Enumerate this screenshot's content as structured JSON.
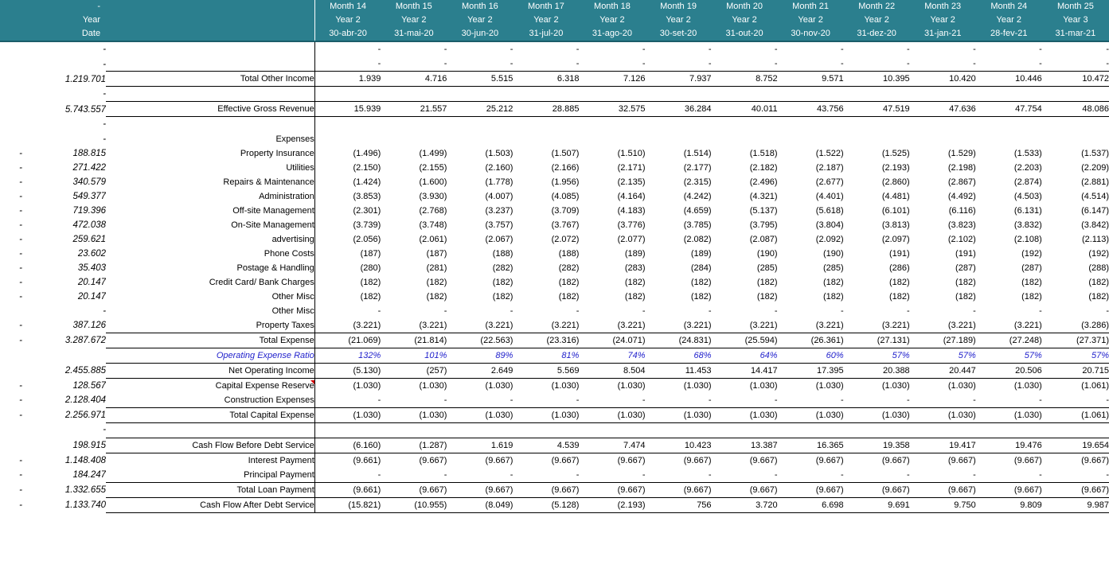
{
  "header": {
    "left_blank_label": "-",
    "row_labels": [
      "",
      "Year",
      "Date"
    ],
    "columns": [
      {
        "month": "Month 14",
        "year": "Year 2",
        "date": "30-abr-20"
      },
      {
        "month": "Month 15",
        "year": "Year 2",
        "date": "31-mai-20"
      },
      {
        "month": "Month 16",
        "year": "Year 2",
        "date": "30-jun-20"
      },
      {
        "month": "Month 17",
        "year": "Year 2",
        "date": "31-jul-20"
      },
      {
        "month": "Month 18",
        "year": "Year 2",
        "date": "31-ago-20"
      },
      {
        "month": "Month 19",
        "year": "Year 2",
        "date": "30-set-20"
      },
      {
        "month": "Month 20",
        "year": "Year 2",
        "date": "31-out-20"
      },
      {
        "month": "Month 21",
        "year": "Year 2",
        "date": "30-nov-20"
      },
      {
        "month": "Month 22",
        "year": "Year 2",
        "date": "31-dez-20"
      },
      {
        "month": "Month 23",
        "year": "Year 2",
        "date": "31-jan-21"
      },
      {
        "month": "Month 24",
        "year": "Year 2",
        "date": "28-fev-21"
      },
      {
        "month": "Month 25",
        "year": "Year 3",
        "date": "31-mar-21"
      }
    ],
    "background_color": "#2b7f8e",
    "text_color": "#ffffff"
  },
  "colors": {
    "header_teal": "#2b7f8e",
    "oer_blue": "#2222cc",
    "comment_red": "#d40000",
    "text": "#000000"
  },
  "rows": [
    {
      "id": "blank-dash-1",
      "label": "",
      "sign": "",
      "ytd": "-",
      "values": [
        "-",
        "-",
        "-",
        "-",
        "-",
        "-",
        "-",
        "-",
        "-",
        "-",
        "-",
        "-"
      ]
    },
    {
      "id": "blank-dash-2",
      "label": "",
      "sign": "",
      "ytd": "-",
      "values": [
        "-",
        "-",
        "-",
        "-",
        "-",
        "-",
        "-",
        "-",
        "-",
        "-",
        "-",
        "-"
      ]
    },
    {
      "id": "total-other-income",
      "label": "Total Other Income",
      "sign": "",
      "ytd": "1.219.701",
      "values": [
        "1.939",
        "4.716",
        "5.515",
        "6.318",
        "7.126",
        "7.937",
        "8.752",
        "9.571",
        "10.395",
        "10.420",
        "10.446",
        "10.472"
      ]
    },
    {
      "id": "spacer-a",
      "label": "",
      "sign": "",
      "ytd": "-",
      "values": [
        "",
        "",
        "",
        "",
        "",
        "",
        "",
        "",
        "",
        "",
        "",
        ""
      ]
    },
    {
      "id": "effective-gross-revenue",
      "label": "Effective Gross Revenue",
      "sign": "",
      "ytd": "5.743.557",
      "values": [
        "15.939",
        "21.557",
        "25.212",
        "28.885",
        "32.575",
        "36.284",
        "40.011",
        "43.756",
        "47.519",
        "47.636",
        "47.754",
        "48.086"
      ]
    },
    {
      "id": "spacer-b",
      "label": "",
      "sign": "",
      "ytd": "-",
      "values": [
        "",
        "",
        "",
        "",
        "",
        "",
        "",
        "",
        "",
        "",
        "",
        ""
      ]
    },
    {
      "id": "expenses-heading",
      "label": "Expenses",
      "sign": "",
      "ytd": "-",
      "values": [
        "",
        "",
        "",
        "",
        "",
        "",
        "",
        "",
        "",
        "",
        "",
        ""
      ]
    },
    {
      "id": "property-insurance",
      "label": "Property Insurance",
      "sign": "-",
      "ytd": "188.815",
      "values": [
        "(1.496)",
        "(1.499)",
        "(1.503)",
        "(1.507)",
        "(1.510)",
        "(1.514)",
        "(1.518)",
        "(1.522)",
        "(1.525)",
        "(1.529)",
        "(1.533)",
        "(1.537)"
      ]
    },
    {
      "id": "utilities",
      "label": "Utilities",
      "sign": "-",
      "ytd": "271.422",
      "values": [
        "(2.150)",
        "(2.155)",
        "(2.160)",
        "(2.166)",
        "(2.171)",
        "(2.177)",
        "(2.182)",
        "(2.187)",
        "(2.193)",
        "(2.198)",
        "(2.203)",
        "(2.209)"
      ]
    },
    {
      "id": "repairs-maintenance",
      "label": "Repairs & Maintenance",
      "sign": "-",
      "ytd": "340.579",
      "values": [
        "(1.424)",
        "(1.600)",
        "(1.778)",
        "(1.956)",
        "(2.135)",
        "(2.315)",
        "(2.496)",
        "(2.677)",
        "(2.860)",
        "(2.867)",
        "(2.874)",
        "(2.881)"
      ]
    },
    {
      "id": "administration",
      "label": "Administration",
      "sign": "-",
      "ytd": "549.377",
      "values": [
        "(3.853)",
        "(3.930)",
        "(4.007)",
        "(4.085)",
        "(4.164)",
        "(4.242)",
        "(4.321)",
        "(4.401)",
        "(4.481)",
        "(4.492)",
        "(4.503)",
        "(4.514)"
      ]
    },
    {
      "id": "off-site-management",
      "label": "Off-site Management",
      "sign": "-",
      "ytd": "719.396",
      "values": [
        "(2.301)",
        "(2.768)",
        "(3.237)",
        "(3.709)",
        "(4.183)",
        "(4.659)",
        "(5.137)",
        "(5.618)",
        "(6.101)",
        "(6.116)",
        "(6.131)",
        "(6.147)"
      ]
    },
    {
      "id": "on-site-management",
      "label": "On-Site Management",
      "sign": "-",
      "ytd": "472.038",
      "values": [
        "(3.739)",
        "(3.748)",
        "(3.757)",
        "(3.767)",
        "(3.776)",
        "(3.785)",
        "(3.795)",
        "(3.804)",
        "(3.813)",
        "(3.823)",
        "(3.832)",
        "(3.842)"
      ]
    },
    {
      "id": "advertising",
      "label": "advertising",
      "sign": "-",
      "ytd": "259.621",
      "values": [
        "(2.056)",
        "(2.061)",
        "(2.067)",
        "(2.072)",
        "(2.077)",
        "(2.082)",
        "(2.087)",
        "(2.092)",
        "(2.097)",
        "(2.102)",
        "(2.108)",
        "(2.113)"
      ]
    },
    {
      "id": "phone-costs",
      "label": "Phone Costs",
      "sign": "-",
      "ytd": "23.602",
      "values": [
        "(187)",
        "(187)",
        "(188)",
        "(188)",
        "(189)",
        "(189)",
        "(190)",
        "(190)",
        "(191)",
        "(191)",
        "(192)",
        "(192)"
      ]
    },
    {
      "id": "postage-handling",
      "label": "Postage & Handling",
      "sign": "-",
      "ytd": "35.403",
      "values": [
        "(280)",
        "(281)",
        "(282)",
        "(282)",
        "(283)",
        "(284)",
        "(285)",
        "(285)",
        "(286)",
        "(287)",
        "(287)",
        "(288)"
      ]
    },
    {
      "id": "credit-card-bank-charges",
      "label": "Credit Card/ Bank  Charges",
      "sign": "-",
      "ytd": "20.147",
      "values": [
        "(182)",
        "(182)",
        "(182)",
        "(182)",
        "(182)",
        "(182)",
        "(182)",
        "(182)",
        "(182)",
        "(182)",
        "(182)",
        "(182)"
      ]
    },
    {
      "id": "other-misc-1",
      "label": "Other Misc",
      "sign": "-",
      "ytd": "20.147",
      "values": [
        "(182)",
        "(182)",
        "(182)",
        "(182)",
        "(182)",
        "(182)",
        "(182)",
        "(182)",
        "(182)",
        "(182)",
        "(182)",
        "(182)"
      ]
    },
    {
      "id": "other-misc-2",
      "label": "Other Misc",
      "sign": "",
      "ytd": "-",
      "values": [
        "-",
        "-",
        "-",
        "-",
        "-",
        "-",
        "-",
        "-",
        "-",
        "-",
        "-",
        "-"
      ]
    },
    {
      "id": "property-taxes",
      "label": "Property Taxes",
      "sign": "-",
      "ytd": "387.126",
      "values": [
        "(3.221)",
        "(3.221)",
        "(3.221)",
        "(3.221)",
        "(3.221)",
        "(3.221)",
        "(3.221)",
        "(3.221)",
        "(3.221)",
        "(3.221)",
        "(3.221)",
        "(3.286)"
      ]
    },
    {
      "id": "total-expense",
      "label": "Total Expense",
      "sign": "-",
      "ytd": "3.287.672",
      "values": [
        "(21.069)",
        "(21.814)",
        "(22.563)",
        "(23.316)",
        "(24.071)",
        "(24.831)",
        "(25.594)",
        "(26.361)",
        "(27.131)",
        "(27.189)",
        "(27.248)",
        "(27.371)"
      ]
    },
    {
      "id": "operating-expense-ratio",
      "label": "Operating Expense Ratio",
      "sign": "",
      "ytd": "",
      "values": [
        "132%",
        "101%",
        "89%",
        "81%",
        "74%",
        "68%",
        "64%",
        "60%",
        "57%",
        "57%",
        "57%",
        "57%"
      ]
    },
    {
      "id": "net-operating-income",
      "label": "Net Operating Income",
      "sign": "",
      "ytd": "2.455.885",
      "values": [
        "(5.130)",
        "(257)",
        "2.649",
        "5.569",
        "8.504",
        "11.453",
        "14.417",
        "17.395",
        "20.388",
        "20.447",
        "20.506",
        "20.715"
      ]
    },
    {
      "id": "capital-expense-reserve",
      "label": "Capital Expense Reserve",
      "sign": "-",
      "ytd": "128.567",
      "values": [
        "(1.030)",
        "(1.030)",
        "(1.030)",
        "(1.030)",
        "(1.030)",
        "(1.030)",
        "(1.030)",
        "(1.030)",
        "(1.030)",
        "(1.030)",
        "(1.030)",
        "(1.061)"
      ]
    },
    {
      "id": "construction-expenses",
      "label": "Construction Expenses",
      "sign": "-",
      "ytd": "2.128.404",
      "values": [
        "-",
        "-",
        "-",
        "-",
        "-",
        "-",
        "-",
        "-",
        "-",
        "-",
        "-",
        "-"
      ]
    },
    {
      "id": "total-capital-expense",
      "label": "Total Capital Expense",
      "sign": "-",
      "ytd": "2.256.971",
      "values": [
        "(1.030)",
        "(1.030)",
        "(1.030)",
        "(1.030)",
        "(1.030)",
        "(1.030)",
        "(1.030)",
        "(1.030)",
        "(1.030)",
        "(1.030)",
        "(1.030)",
        "(1.061)"
      ]
    },
    {
      "id": "spacer-c",
      "label": "",
      "sign": "",
      "ytd": "-",
      "values": [
        "",
        "",
        "",
        "",
        "",
        "",
        "",
        "",
        "",
        "",
        "",
        ""
      ]
    },
    {
      "id": "cash-flow-before-debt-service",
      "label": "Cash  Flow Before Debt Service",
      "sign": "",
      "ytd": "198.915",
      "values": [
        "(6.160)",
        "(1.287)",
        "1.619",
        "4.539",
        "7.474",
        "10.423",
        "13.387",
        "16.365",
        "19.358",
        "19.417",
        "19.476",
        "19.654"
      ]
    },
    {
      "id": "interest-payment",
      "label": "Interest Payment",
      "sign": "-",
      "ytd": "1.148.408",
      "values": [
        "(9.661)",
        "(9.667)",
        "(9.667)",
        "(9.667)",
        "(9.667)",
        "(9.667)",
        "(9.667)",
        "(9.667)",
        "(9.667)",
        "(9.667)",
        "(9.667)",
        "(9.667)"
      ]
    },
    {
      "id": "principal-payment",
      "label": "Principal Payment",
      "sign": "-",
      "ytd": "184.247",
      "values": [
        "-",
        "-",
        "-",
        "-",
        "-",
        "-",
        "-",
        "-",
        "-",
        "-",
        "-",
        "-"
      ]
    },
    {
      "id": "total-loan-payment",
      "label": "Total Loan Payment",
      "sign": "-",
      "ytd": "1.332.655",
      "values": [
        "(9.661)",
        "(9.667)",
        "(9.667)",
        "(9.667)",
        "(9.667)",
        "(9.667)",
        "(9.667)",
        "(9.667)",
        "(9.667)",
        "(9.667)",
        "(9.667)",
        "(9.667)"
      ]
    },
    {
      "id": "cash-flow-after-debt-service",
      "label": "Cash Flow After Debt Service",
      "sign": "-",
      "ytd": "1.133.740",
      "values": [
        "(15.821)",
        "(10.955)",
        "(8.049)",
        "(5.128)",
        "(2.193)",
        "756",
        "3.720",
        "6.698",
        "9.691",
        "9.750",
        "9.809",
        "9.987"
      ]
    }
  ]
}
